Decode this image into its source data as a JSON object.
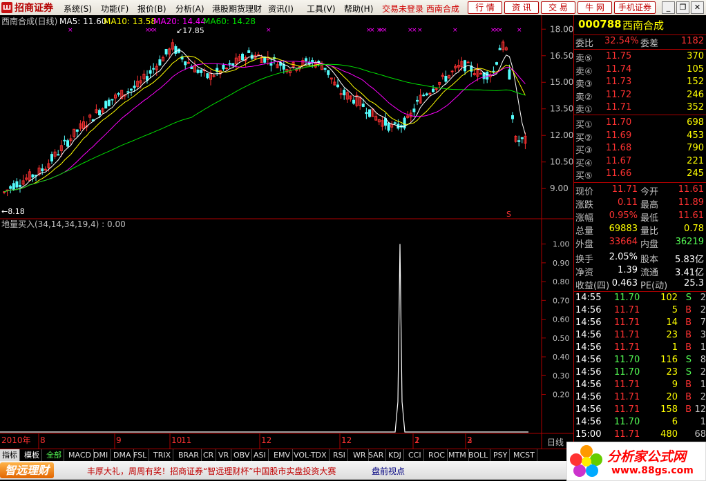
{
  "menubar": {
    "brand": "招商证券",
    "items": [
      "系统(S)",
      "功能(F)",
      "报价(B)",
      "分析(A)",
      "港股期货理财",
      "资讯(I)",
      "工具(V)",
      "帮助(H)"
    ],
    "login": "交易未登录 西南合成",
    "buttons": [
      "行 情",
      "资 讯",
      "交 易",
      "牛 网",
      "手机证券"
    ]
  },
  "chart": {
    "title": "西南合成(日线)",
    "ma5": "MA5: 11.60",
    "ma10": "MA10: 13.58",
    "ma20": "MA20: 14.44",
    "ma60": "MA60: 14.28",
    "high_label": "17.85",
    "low_label": "←8.18",
    "price_ticks": [
      "18.00",
      "16.50",
      "15.00",
      "13.50",
      "12.00",
      "10.50",
      "9.00"
    ],
    "indicator_label": "地量买入(34,14,34,19,4) : 0.00",
    "indicator_ticks": [
      "1.00",
      "0.90",
      "0.80",
      "0.70",
      "0.60",
      "0.50",
      "0.40",
      "0.30",
      "0.20"
    ],
    "x_labels": [
      "2010年",
      "8",
      "9",
      "10",
      "11",
      "12",
      "1",
      "2",
      "3"
    ],
    "period": "日线",
    "s_marker": "S"
  },
  "quote": {
    "code": "000788",
    "name": "西南合成",
    "weibi_label": "委比",
    "weibi": "32.54%",
    "weicha_label": "委差",
    "weicha": "1182",
    "asks": [
      {
        "label": "卖⑤",
        "price": "11.75",
        "vol": "370"
      },
      {
        "label": "卖④",
        "price": "11.74",
        "vol": "105"
      },
      {
        "label": "卖③",
        "price": "11.73",
        "vol": "152"
      },
      {
        "label": "卖②",
        "price": "11.72",
        "vol": "246"
      },
      {
        "label": "卖①",
        "price": "11.71",
        "vol": "352"
      }
    ],
    "bids": [
      {
        "label": "买①",
        "price": "11.70",
        "vol": "698"
      },
      {
        "label": "买②",
        "price": "11.69",
        "vol": "453"
      },
      {
        "label": "买③",
        "price": "11.68",
        "vol": "790"
      },
      {
        "label": "买④",
        "price": "11.67",
        "vol": "221"
      },
      {
        "label": "买⑤",
        "price": "11.66",
        "vol": "245"
      }
    ],
    "stats": [
      {
        "l1": "现价",
        "v1": "11.71",
        "l2": "今开",
        "v2": "11.61"
      },
      {
        "l1": "涨跌",
        "v1": "0.11",
        "l2": "最高",
        "v2": "11.89"
      },
      {
        "l1": "涨幅",
        "v1": "0.95%",
        "l2": "最低",
        "v2": "11.61"
      },
      {
        "l1": "总量",
        "v1": "69883",
        "l2": "量比",
        "v2": "0.78"
      },
      {
        "l1": "外盘",
        "v1": "33664",
        "l2": "内盘",
        "v2": "36219"
      },
      {
        "l1": "换手",
        "v1": "2.05%",
        "l2": "股本",
        "v2": "5.83亿"
      },
      {
        "l1": "净资",
        "v1": "1.39",
        "l2": "流通",
        "v2": "3.41亿"
      },
      {
        "l1": "收益(四)",
        "v1": "0.463",
        "l2": "PE(动)",
        "v2": "25.3"
      }
    ],
    "ticks": [
      {
        "t": "14:55",
        "p": "11.70",
        "v": "102",
        "s": "S",
        "n": "2"
      },
      {
        "t": "14:56",
        "p": "11.71",
        "v": "5",
        "s": "B",
        "n": "2"
      },
      {
        "t": "14:56",
        "p": "11.71",
        "v": "14",
        "s": "B",
        "n": "7"
      },
      {
        "t": "14:56",
        "p": "11.71",
        "v": "23",
        "s": "B",
        "n": "3"
      },
      {
        "t": "14:56",
        "p": "11.71",
        "v": "1",
        "s": "B",
        "n": "1"
      },
      {
        "t": "14:56",
        "p": "11.70",
        "v": "116",
        "s": "S",
        "n": "8"
      },
      {
        "t": "14:56",
        "p": "11.70",
        "v": "23",
        "s": "S",
        "n": "2"
      },
      {
        "t": "14:56",
        "p": "11.71",
        "v": "9",
        "s": "B",
        "n": "1"
      },
      {
        "t": "14:56",
        "p": "11.71",
        "v": "20",
        "s": "B",
        "n": "2"
      },
      {
        "t": "14:56",
        "p": "11.71",
        "v": "158",
        "s": "B",
        "n": "12"
      },
      {
        "t": "14:56",
        "p": "11.70",
        "v": "6",
        "s": "",
        "n": "1"
      },
      {
        "t": "15:00",
        "p": "11.71",
        "v": "480",
        "s": "",
        "n": "68"
      }
    ]
  },
  "tabs": [
    "指标",
    "模板",
    "全部",
    "MACD",
    "DMI",
    "DMA",
    "FSL",
    "TRIX",
    "BRAR",
    "CR",
    "VR",
    "OBV",
    "ASI",
    "EMV",
    "VOL-TDX",
    "RSI",
    "WR",
    "SAR",
    "KDJ",
    "CCI",
    "ROC",
    "MTM",
    "BOLL",
    "PSY",
    "MCST"
  ],
  "status": {
    "brand": "智远理财",
    "ticker": "丰厚大礼，周周有奖！招商证券“智远理财杯”中国股市实盘投资大赛",
    "session": "盘前视点"
  },
  "watermark": {
    "title": "分析家公式网",
    "url": "www.88gs.com"
  },
  "colors": {
    "up": "#ff3232",
    "down": "#54fcfc",
    "ma5": "#ffffff",
    "ma10": "#ffff00",
    "ma20": "#ff00ff",
    "ma60": "#00e000",
    "grid": "#b00000",
    "label": "#c0c0c0"
  },
  "chart_data": {
    "type": "candlestick",
    "ylim": [
      7.8,
      18.4
    ],
    "high": 17.85,
    "low": 8.18,
    "indicator": {
      "name": "地量买入",
      "ylim": [
        0,
        1.05
      ],
      "spike_value": 1.0,
      "spike_position": "late Jan"
    },
    "series": [
      {
        "name": "MA5",
        "last": 11.6
      },
      {
        "name": "MA10",
        "last": 13.58
      },
      {
        "name": "MA20",
        "last": 14.44
      },
      {
        "name": "MA60",
        "last": 14.28
      }
    ]
  }
}
